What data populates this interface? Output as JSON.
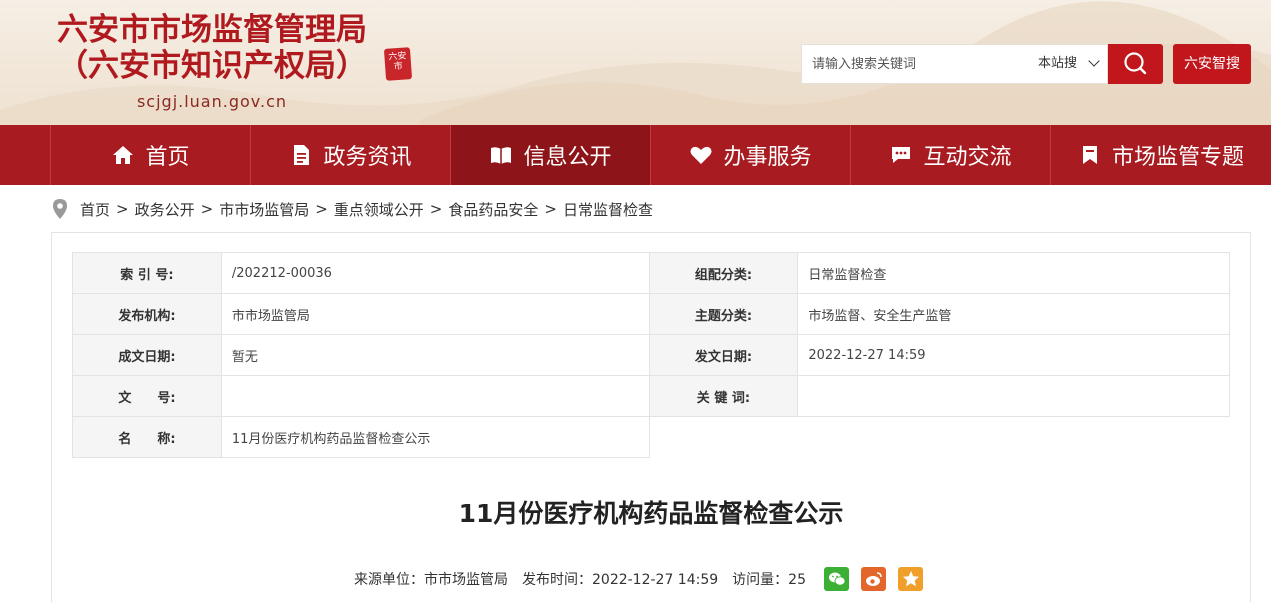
{
  "header": {
    "title_line1": "六安市市场监督管理局",
    "title_line2": "（六安市知识产权局）",
    "domain": "scjgj.luan.gov.cn",
    "seal_text": "六安市"
  },
  "search": {
    "placeholder": "请输入搜索关键词",
    "scope": "本站搜",
    "zhisou_label": "六安智搜"
  },
  "nav": {
    "items": [
      {
        "label": "首页",
        "icon": "home-icon"
      },
      {
        "label": "政务资讯",
        "icon": "document-icon"
      },
      {
        "label": "信息公开",
        "icon": "book-icon"
      },
      {
        "label": "办事服务",
        "icon": "heart-icon"
      },
      {
        "label": "互动交流",
        "icon": "chat-icon"
      },
      {
        "label": "市场监管专题",
        "icon": "bookmark-icon"
      }
    ],
    "active_index": 2
  },
  "breadcrumb": [
    "首页",
    "政务公开",
    "市市场监管局",
    "重点领域公开",
    "食品药品安全",
    "日常监督检查"
  ],
  "meta": {
    "index_label": "索 引 号:",
    "index_value": "/202212-00036",
    "category_label": "组配分类:",
    "category_value": "日常监督检查",
    "publisher_label": "发布机构:",
    "publisher_value": "市市场监管局",
    "topic_label": "主题分类:",
    "topic_value": "市场监督、安全生产监管",
    "created_label": "成文日期:",
    "created_value": "暂无",
    "issued_label": "发文日期:",
    "issued_value": "2022-12-27 14:59",
    "docno_label": "文　　号:",
    "docno_value": "",
    "keywords_label": "关 键 词:",
    "keywords_value": "",
    "name_label": "名　　称:",
    "name_value": "11月份医疗机构药品监督检查公示"
  },
  "article": {
    "title": "11月份医疗机构药品监督检查公示",
    "source": "来源单位：市市场监管局",
    "time": "发布时间：2022-12-27 14:59",
    "visits": "访问量：25"
  },
  "colors": {
    "brand_red": "#a81b20",
    "nav_active": "#8d1418",
    "search_red": "#c0161c"
  }
}
